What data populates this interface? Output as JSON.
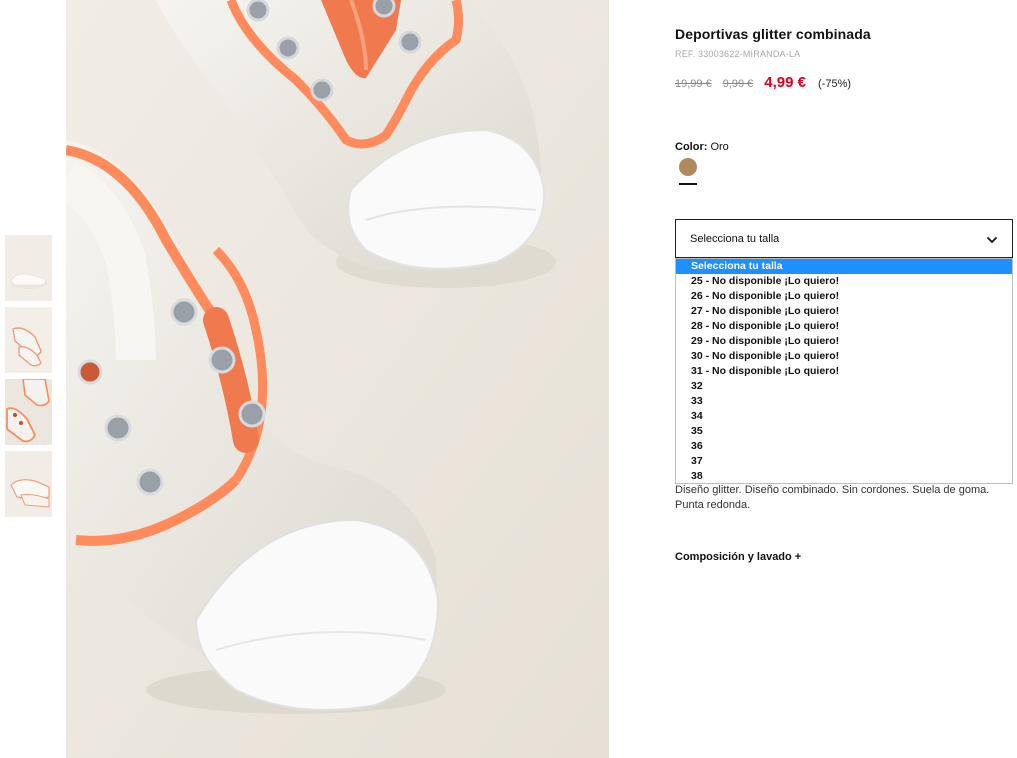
{
  "product": {
    "title": "Deportivas glitter combinada",
    "ref": "REF. 33003622-MIRANDA-LA",
    "price_original": "19,99 €",
    "price_previous": "9,99 €",
    "price_current": "4,99 €",
    "discount": "(-75%)"
  },
  "color": {
    "label": "Color:",
    "value": "Oro",
    "swatch_hex": "#b08a5c"
  },
  "size_select": {
    "selected_label": "Selecciona tu talla",
    "options": [
      "Selecciona tu talla",
      "25 - No disponible ¡Lo quiero!",
      "26 - No disponible ¡Lo quiero!",
      "27 - No disponible ¡Lo quiero!",
      "28 - No disponible ¡Lo quiero!",
      "29 - No disponible ¡Lo quiero!",
      "30 - No disponible ¡Lo quiero!",
      "31 - No disponible ¡Lo quiero!",
      "32",
      "33",
      "34",
      "35",
      "36",
      "37",
      "38"
    ]
  },
  "description": "Diseño glitter. Diseño combinado. Sin cordones. Suela de goma. Punta redonda.",
  "composition_label": "Composición y lavado +",
  "colors": {
    "accent_red": "#e0001b",
    "highlight_blue": "#1e90ff",
    "shoe_orange": "#ff8a5c"
  },
  "icons": {
    "select_chevron": "chevron-down-icon"
  }
}
